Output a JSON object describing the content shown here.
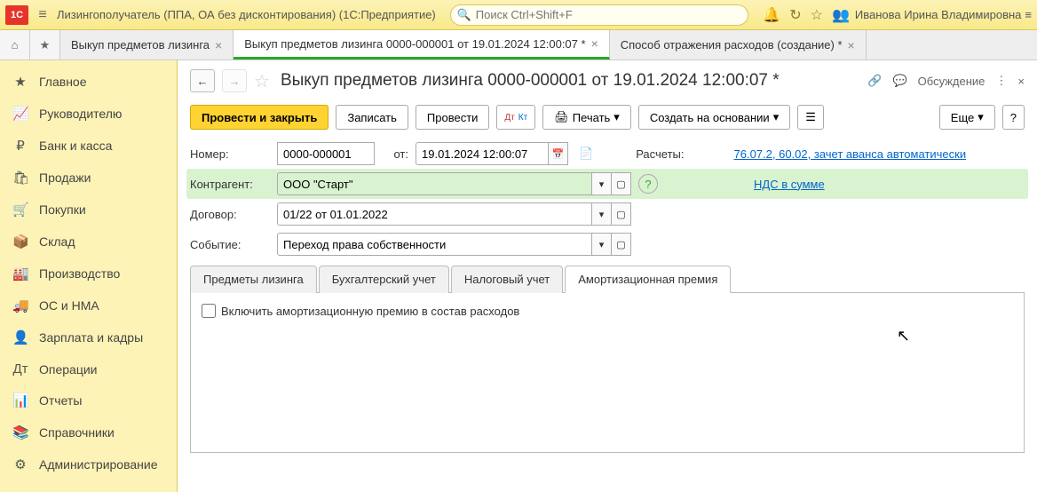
{
  "topbar": {
    "title": "Лизингополучатель (ППА, ОА без дисконтирования)  (1С:Предприятие)",
    "search_placeholder": "Поиск Ctrl+Shift+F",
    "user": "Иванова Ирина Владимировна"
  },
  "app_tabs": [
    {
      "label": "Выкуп предметов лизинга",
      "active": false
    },
    {
      "label": "Выкуп предметов лизинга 0000-000001 от 19.01.2024 12:00:07 *",
      "active": true
    },
    {
      "label": "Способ отражения расходов (создание) *",
      "active": false
    }
  ],
  "sidebar": [
    {
      "icon": "★",
      "label": "Главное"
    },
    {
      "icon": "📈",
      "label": "Руководителю"
    },
    {
      "icon": "₽",
      "label": "Банк и касса"
    },
    {
      "icon": "🛍",
      "label": "Продажи"
    },
    {
      "icon": "🛒",
      "label": "Покупки"
    },
    {
      "icon": "📦",
      "label": "Склад"
    },
    {
      "icon": "🏭",
      "label": "Производство"
    },
    {
      "icon": "🚚",
      "label": "ОС и НМА"
    },
    {
      "icon": "👤",
      "label": "Зарплата и кадры"
    },
    {
      "icon": "Дт",
      "label": "Операции"
    },
    {
      "icon": "📊",
      "label": "Отчеты"
    },
    {
      "icon": "📚",
      "label": "Справочники"
    },
    {
      "icon": "⚙",
      "label": "Администрирование"
    }
  ],
  "heading": "Выкуп предметов лизинга 0000-000001 от 19.01.2024 12:00:07 *",
  "discussion": "Обсуждение",
  "toolbar": {
    "post_close": "Провести и закрыть",
    "save": "Записать",
    "post": "Провести",
    "print": "Печать",
    "create_based": "Создать на основании",
    "more": "Еще"
  },
  "form": {
    "number_label": "Номер:",
    "number": "0000-000001",
    "from_label": "от:",
    "date": "19.01.2024 12:00:07",
    "contractor_label": "Контрагент:",
    "contractor": "ООО \"Старт\"",
    "contract_label": "Договор:",
    "contract": "01/22 от 01.01.2022",
    "event_label": "Событие:",
    "event": "Переход права собственности",
    "settlements_label": "Расчеты:",
    "settlements_link": "76.07.2, 60.02, зачет аванса автоматически",
    "vat_link": "НДС в сумме"
  },
  "doc_tabs": [
    "Предметы лизинга",
    "Бухгалтерский учет",
    "Налоговый учет",
    "Амортизационная премия"
  ],
  "checkbox_label": "Включить амортизационную премию в состав расходов"
}
